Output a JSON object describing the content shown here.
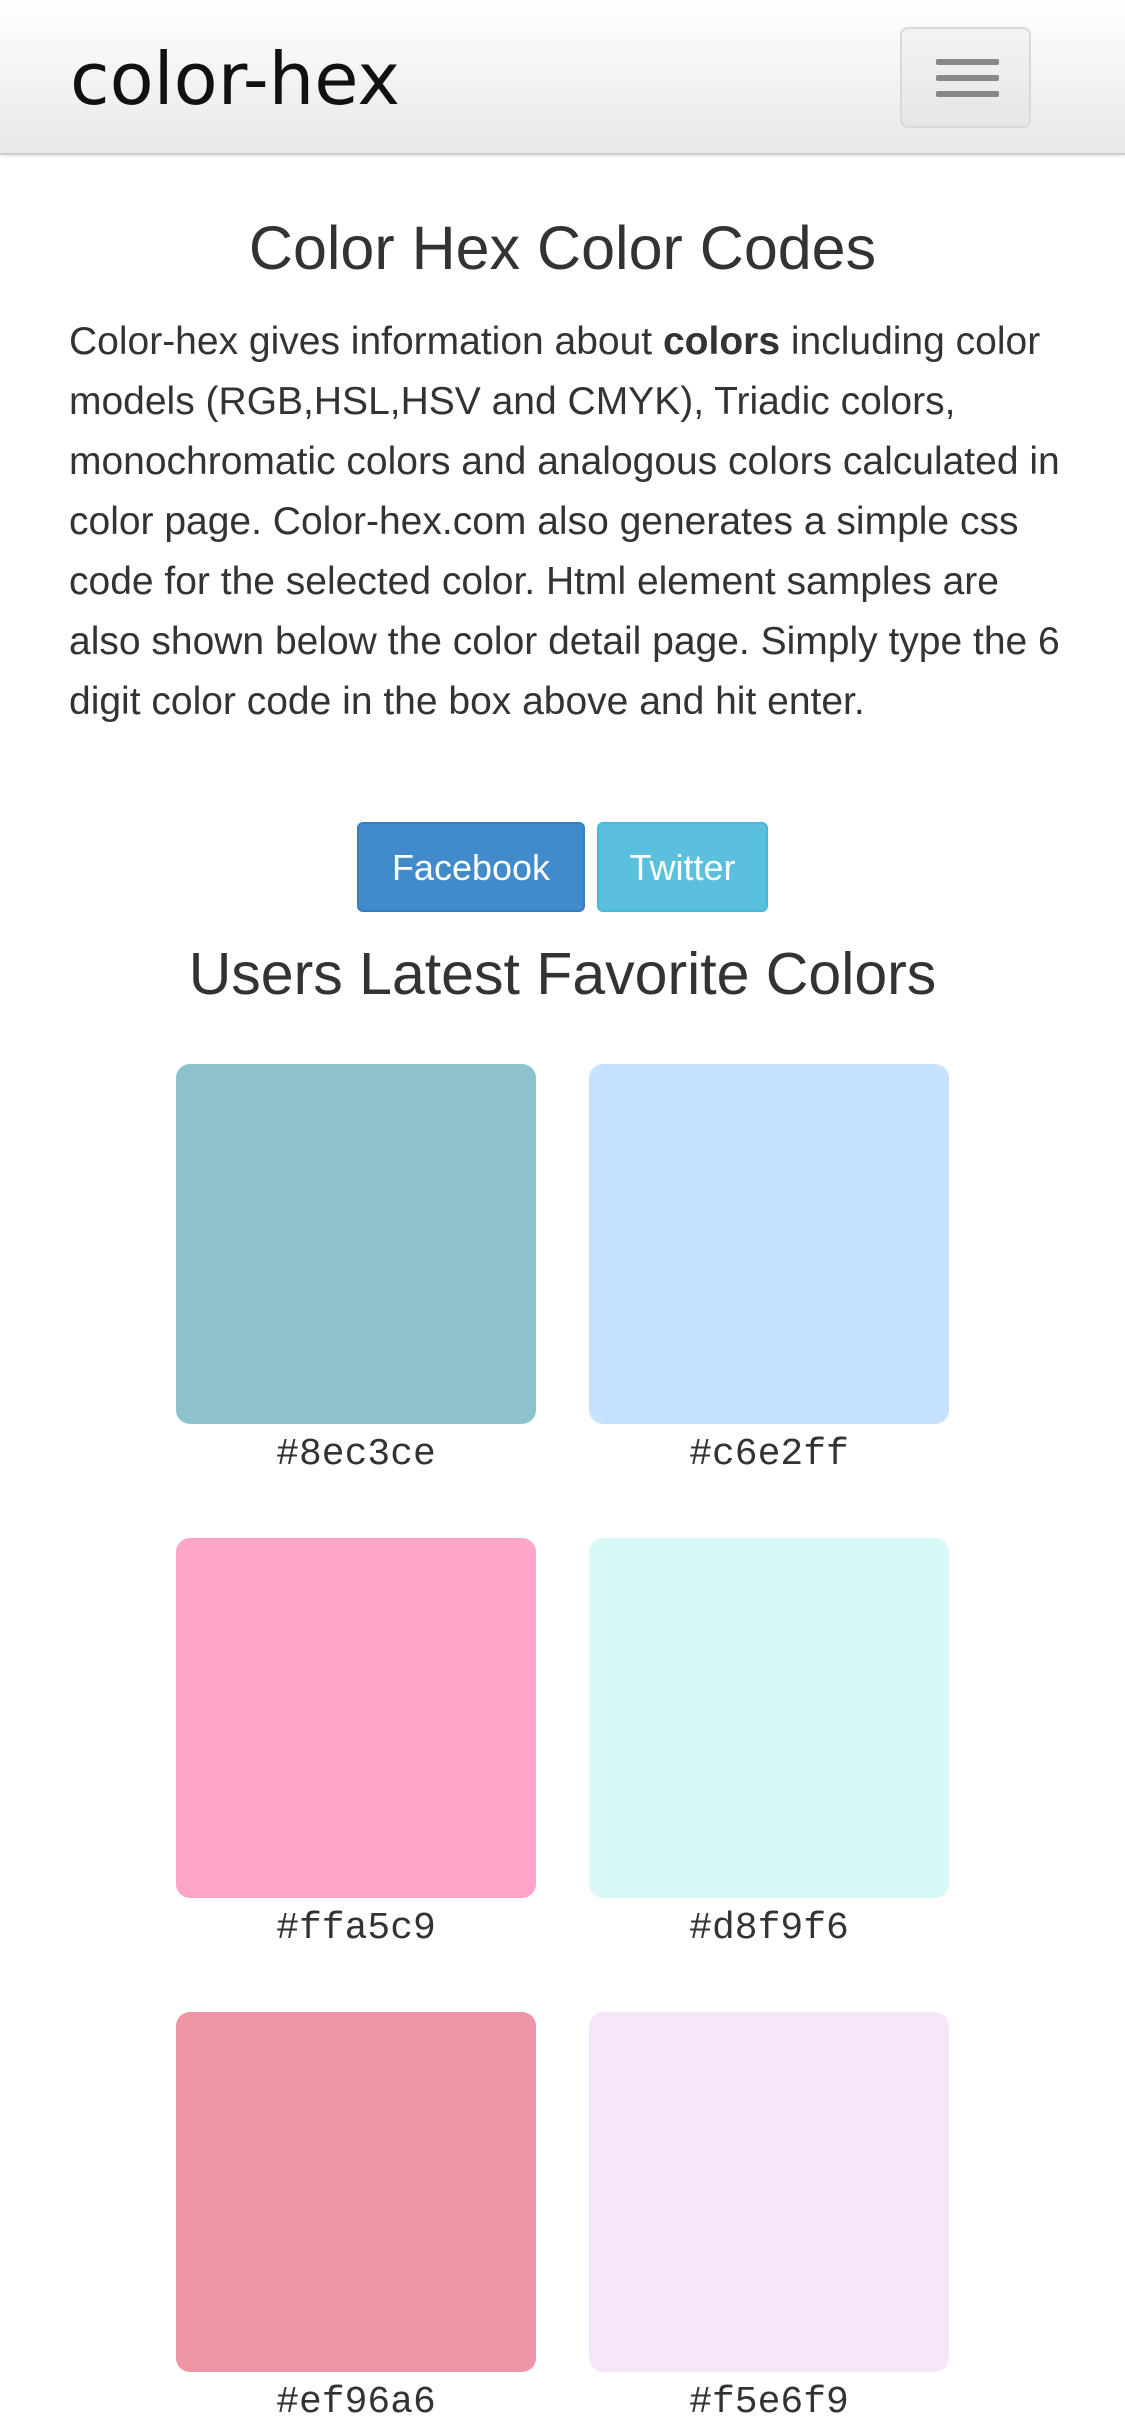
{
  "navbar": {
    "brand": "color-hex",
    "menu_icon": "hamburger-icon"
  },
  "main": {
    "title": "Color Hex Color Codes",
    "intro": {
      "before": "Color-hex gives information about ",
      "bold": "colors",
      "after": " including color models (RGB,HSL,HSV and CMYK), Triadic colors, monochromatic colors and analogous colors calculated in color page. Color-hex.com also generates a simple css code for the selected color. Html element samples are also shown below the color detail page. Simply type the 6 digit color code in the box above and hit enter."
    },
    "social": {
      "facebook_label": "Facebook",
      "twitter_label": "Twitter"
    },
    "favorites_title": "Users Latest Favorite Colors",
    "favorites": [
      {
        "code": "#8ec3ce",
        "color": "#8ec3ce"
      },
      {
        "code": "#c6e2ff",
        "color": "#c6e2ff"
      },
      {
        "code": "#ffa5c9",
        "color": "#ffa5c9"
      },
      {
        "code": "#d8f9f6",
        "color": "#d8f9f6"
      },
      {
        "code": "#ef96a6",
        "color": "#ef96a6"
      },
      {
        "code": "#f5e6f9",
        "color": "#f5e6f9"
      }
    ]
  },
  "colors": {
    "facebook": "#428bca",
    "twitter": "#5bc0de",
    "text": "#333333"
  }
}
